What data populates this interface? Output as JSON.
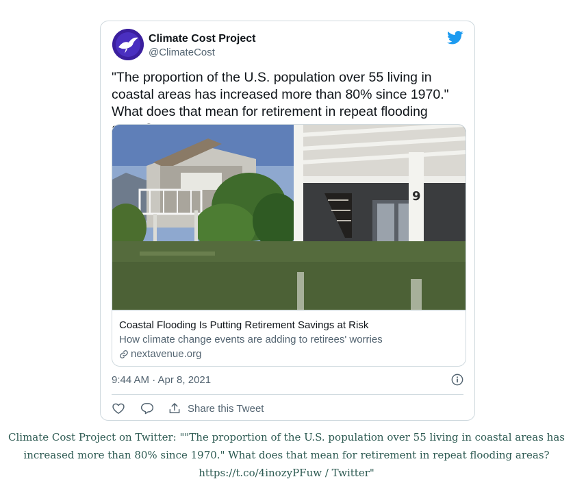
{
  "tweet": {
    "author_name": "Climate Cost Project",
    "handle": "@ClimateCost",
    "text_lines": [
      "\"The proportion of the U.S. population over 55 living in",
      "coastal areas has increased more than 80% since 1970.\"",
      "What does that mean for retirement in repeat flooding areas?"
    ],
    "link_card": {
      "title": "Coastal Flooding Is Putting Retirement Savings at Risk",
      "description": "How climate change events are adding to retirees' worries",
      "domain": "nextavenue.org",
      "house_number": "9"
    },
    "timestamp": "9:44 AM · Apr 8, 2021",
    "share_label": "Share this Tweet"
  },
  "caption": {
    "lines": [
      "Climate Cost Project on Twitter: \"\"The proportion of the U.S. population over 55 living in coastal areas has",
      "increased more than 80% since 1970.\" What does that mean for retirement in repeat flooding areas?",
      "https://t.co/4inozyPFuw / Twitter\""
    ]
  },
  "icons": {
    "brand": "twitter-bird-icon",
    "like": "heart-icon",
    "reply": "speech-bubble-icon",
    "share": "share-upload-icon",
    "info": "info-icon",
    "link": "link-icon"
  },
  "colors": {
    "twitter_blue": "#1d9bf0",
    "avatar_bg": "#3b1f9e",
    "caption_text": "#2d5a52",
    "secondary_text": "#536471"
  }
}
